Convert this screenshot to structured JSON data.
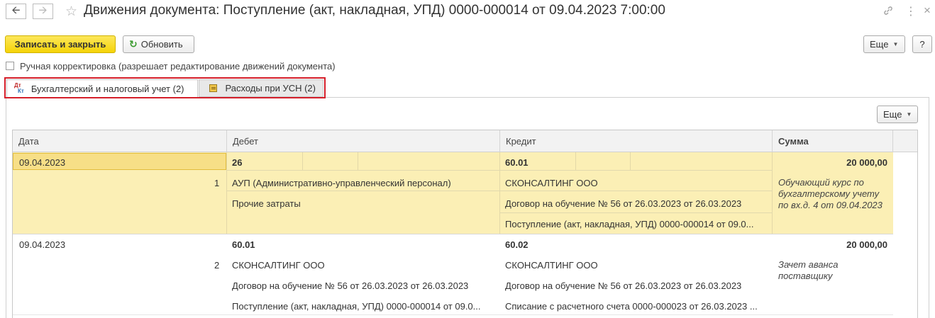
{
  "window": {
    "title": "Движения документа: Поступление (акт, накладная, УПД) 0000-000014 от 09.04.2023 7:00:00"
  },
  "icons": {
    "back": "arrow-left-icon",
    "forward": "arrow-right-icon",
    "favorite": "star-icon",
    "link": "link-icon",
    "menu": "more-vertical-icon",
    "close": "close-icon",
    "refresh": "refresh-icon",
    "tab1": "dt-kt-icon",
    "tab2": "ledger-icon"
  },
  "toolbar": {
    "save_close": "Записать и закрыть",
    "refresh": "Обновить",
    "more": "Еще",
    "help": "?"
  },
  "manual_correction": {
    "label": "Ручная корректировка (разрешает редактирование движений документа)",
    "checked": false
  },
  "tabs": [
    {
      "label": "Бухгалтерский и налоговый учет (2)",
      "active": true
    },
    {
      "label": "Расходы при УСН (2)",
      "active": false
    }
  ],
  "table": {
    "more": "Еще",
    "columns": [
      "Дата",
      "Дебет",
      "Кредит",
      "Сумма"
    ],
    "rows": [
      {
        "date": "09.04.2023",
        "num": "1",
        "debit_account": "26",
        "debit_sub1": "АУП (Административно-управленческий персонал)",
        "debit_sub2": "Прочие затраты",
        "credit_account": "60.01",
        "credit_sub1": "СКОНСАЛТИНГ ООО",
        "credit_sub2": "Договор на обучение № 56 от 26.03.2023 от 26.03.2023",
        "credit_sub3": "Поступление (акт, накладная, УПД) 0000-000014 от 09.0...",
        "amount": "20 000,00",
        "content": "Обучающий курс по бухгалтерскому учету по вх.д. 4 от 09.04.2023"
      },
      {
        "date": "09.04.2023",
        "num": "2",
        "debit_account": "60.01",
        "debit_sub1": "СКОНСАЛТИНГ ООО",
        "debit_sub2": "Договор на обучение № 56 от 26.03.2023 от 26.03.2023",
        "debit_sub3": "Поступление (акт, накладная, УПД) 0000-000014 от 09.0...",
        "credit_account": "60.02",
        "credit_sub1": "СКОНСАЛТИНГ ООО",
        "credit_sub2": "Договор на обучение № 56 от 26.03.2023 от 26.03.2023",
        "credit_sub3": "Списание с расчетного счета 0000-000023 от 26.03.2023 ...",
        "amount": "20 000,00",
        "content": "Зачет аванса поставщику"
      }
    ]
  }
}
